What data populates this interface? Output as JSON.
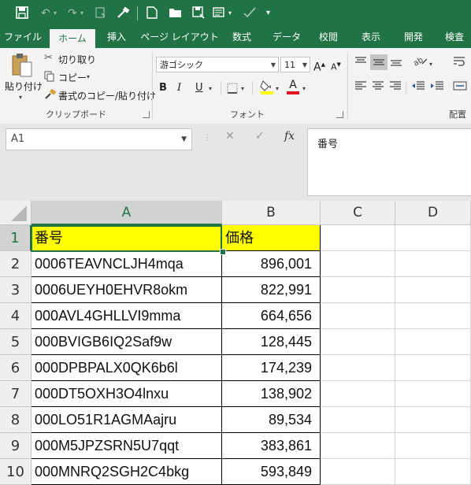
{
  "quick_access": {
    "customize_label": "▾"
  },
  "tabs": [
    "ファイル",
    "ホーム",
    "挿入",
    "ページ レイアウト",
    "数式",
    "データ",
    "校閲",
    "表示",
    "開発",
    "検査"
  ],
  "active_tab": "ホーム",
  "ribbon": {
    "clipboard": {
      "paste_label": "貼り付け",
      "cut_label": "切り取り",
      "copy_label": "コピー",
      "format_painter_label": "書式のコピー/貼り付け",
      "group_label": "クリップボード"
    },
    "font": {
      "font_name": "游ゴシック",
      "font_size": "11",
      "bold": "B",
      "italic": "I",
      "underline": "U",
      "group_label": "フォント"
    },
    "alignment": {
      "group_label": "配置"
    }
  },
  "formula_bar": {
    "name_box": "A1",
    "fx_label": "fx",
    "content": "番号"
  },
  "sheet": {
    "columns": [
      "A",
      "B",
      "C",
      "D"
    ],
    "rows": [
      {
        "num": "1",
        "a": "番号",
        "b": "価格"
      },
      {
        "num": "2",
        "a": "0006TEAVNCLJH4mqa",
        "b": "896,001"
      },
      {
        "num": "3",
        "a": "0006UEYH0EHVR8okm",
        "b": "822,991"
      },
      {
        "num": "4",
        "a": "000AVL4GHLLVI9mma",
        "b": "664,656"
      },
      {
        "num": "5",
        "a": "000BVIGB6IQ2Saf9w",
        "b": "128,445"
      },
      {
        "num": "6",
        "a": "000DPBPALX0QK6b6l",
        "b": "174,239"
      },
      {
        "num": "7",
        "a": "000DT5OXH3O4lnxu",
        "b": "138,902"
      },
      {
        "num": "8",
        "a": "000LO51R1AGMAajru",
        "b": "89,534"
      },
      {
        "num": "9",
        "a": "000M5JPZSRN5U7qqt",
        "b": "383,861"
      },
      {
        "num": "10",
        "a": "000MNRQ2SGH2C4bkg",
        "b": "593,849"
      }
    ],
    "header_fill_color": "#ffff00",
    "accent_color": "#217346"
  }
}
